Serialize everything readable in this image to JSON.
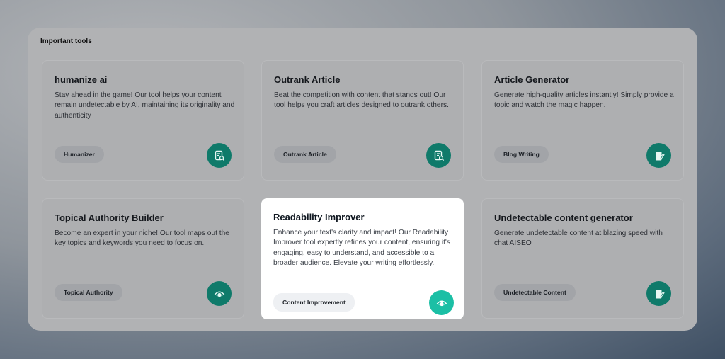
{
  "section_title": "Important tools",
  "colors": {
    "accent": "#1bbfa5",
    "accent_dim": "#0f7a6a",
    "panel": "#b1b2b4"
  },
  "cards": [
    {
      "title": "humanize ai",
      "description": "Stay ahead in the game! Our tool helps your content remain undetectable by AI, maintaining its originality and authenticity",
      "tag": "Humanizer",
      "icon": "document-search-icon"
    },
    {
      "title": "Outrank Article",
      "description": "Beat the competition with content that stands out! Our tool helps you craft articles designed to outrank others.",
      "tag": "Outrank Article",
      "icon": "document-search-icon"
    },
    {
      "title": "Article Generator",
      "description": "Generate high-quality articles instantly! Simply provide a topic and watch the magic happen.",
      "tag": "Blog Writing",
      "icon": "document-edit-icon"
    },
    {
      "title": "Topical Authority Builder",
      "description": "Become an expert in your niche! Our tool maps out the key topics and keywords you need to focus on.",
      "tag": "Topical Authority",
      "icon": "eye-icon"
    },
    {
      "title": "Readability Improver",
      "description": "Enhance your text's clarity and impact! Our Readability Improver tool expertly refines your content, ensuring it's engaging, easy to understand, and accessible to a broader audience. Elevate your writing effortlessly.",
      "tag": "Content Improvement",
      "icon": "eye-icon"
    },
    {
      "title": "Undetectable content generator",
      "description": "Generate undetectable content at blazing speed with chat AISEO",
      "tag": "Undetectable Content",
      "icon": "document-edit-icon"
    }
  ]
}
